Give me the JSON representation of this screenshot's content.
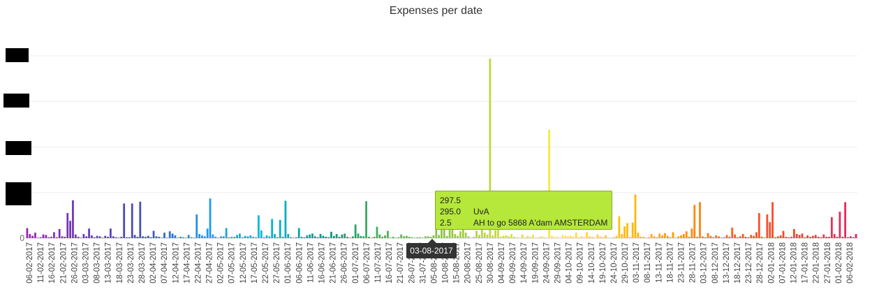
{
  "chart_data": {
    "type": "bar",
    "title": "Expenses per date",
    "xlabel": "",
    "ylabel": "",
    "ylim": [
      0,
      400
    ],
    "y_ticks": [
      {
        "value": 0,
        "label": "0"
      }
    ],
    "grid": "horizontal",
    "x_tick_labels": [
      "06-02-2017",
      "11-02-2017",
      "16-02-2017",
      "21-02-2017",
      "26-02-2017",
      "03-03-2017",
      "08-03-2017",
      "13-03-2017",
      "18-03-2017",
      "23-03-2017",
      "28-03-2017",
      "02-04-2017",
      "07-04-2017",
      "12-04-2017",
      "17-04-2017",
      "22-04-2017",
      "27-04-2017",
      "02-05-2017",
      "07-05-2017",
      "12-05-2017",
      "17-05-2017",
      "22-05-2017",
      "27-05-2017",
      "01-06-2017",
      "06-06-2017",
      "11-06-2017",
      "16-06-2017",
      "21-06-2017",
      "26-06-2017",
      "01-07-2017",
      "06-07-2017",
      "11-07-2017",
      "16-07-2017",
      "21-07-2017",
      "26-07-2017",
      "31-07-2017",
      "05-08-2017",
      "10-08-2017",
      "15-08-2017",
      "20-08-2017",
      "25-08-2017",
      "30-08-2017",
      "04-09-2017",
      "09-09-2017",
      "14-09-2017",
      "19-09-2017",
      "24-09-2017",
      "29-09-2017",
      "04-10-2017",
      "09-10-2017",
      "14-10-2017",
      "19-10-2017",
      "24-10-2017",
      "29-10-2017",
      "03-11-2017",
      "08-11-2017",
      "13-11-2017",
      "18-11-2017",
      "23-11-2017",
      "28-11-2017",
      "03-12-2017",
      "08-12-2017",
      "13-12-2017",
      "18-12-2017",
      "23-12-2017",
      "28-12-2017",
      "02-01-2018",
      "07-01-2018",
      "12-01-2018",
      "17-01-2018",
      "22-01-2018",
      "27-01-2018",
      "01-02-2018",
      "06-02-2018"
    ],
    "values": [
      22,
      9,
      5,
      12,
      1,
      2,
      8,
      7,
      2,
      3,
      13,
      2,
      20,
      4,
      3,
      55,
      38,
      83,
      8,
      3,
      1,
      9,
      4,
      21,
      6,
      2,
      5,
      4,
      1,
      5,
      3,
      21,
      4,
      2,
      1,
      3,
      76,
      2,
      2,
      76,
      7,
      3,
      80,
      4,
      3,
      5,
      2,
      16,
      4,
      3,
      1,
      12,
      1,
      15,
      10,
      6,
      1,
      3,
      2,
      1,
      7,
      2,
      1,
      52,
      9,
      6,
      4,
      21,
      87,
      8,
      3,
      1,
      4,
      4,
      22,
      2,
      3,
      3,
      7,
      10,
      2,
      5,
      4,
      6,
      3,
      2,
      50,
      17,
      2,
      6,
      4,
      42,
      9,
      2,
      40,
      3,
      82,
      9,
      2,
      1,
      2,
      22,
      3,
      2,
      6,
      8,
      10,
      4,
      2,
      9,
      5,
      3,
      2,
      14,
      5,
      9,
      3,
      8,
      10,
      3,
      1,
      4,
      30,
      10,
      5,
      4,
      81,
      3,
      1,
      3,
      25,
      8,
      3,
      6,
      16,
      1,
      3,
      1,
      2,
      8,
      4,
      5,
      3,
      2,
      1,
      2,
      2,
      1,
      4,
      4,
      3,
      6,
      45,
      7,
      19,
      26,
      5,
      98,
      22,
      9,
      5,
      15,
      20,
      12,
      4,
      1,
      3,
      16,
      7,
      24,
      12,
      8,
      394,
      6,
      18,
      35,
      3,
      5,
      6,
      4,
      9,
      3,
      2,
      1,
      8,
      2,
      5,
      3,
      7,
      1,
      2,
      4,
      3,
      1,
      238,
      5,
      3,
      3,
      1,
      7,
      5,
      4,
      5,
      3,
      12,
      2,
      4,
      2,
      13,
      4,
      3,
      1,
      8,
      3,
      2,
      6,
      1,
      1,
      2,
      5,
      48,
      9,
      26,
      33,
      2,
      34,
      96,
      12,
      3,
      3,
      1,
      2,
      9,
      4,
      2,
      10,
      6,
      11,
      5,
      2,
      13,
      1,
      4,
      6,
      9,
      15,
      3,
      21,
      73,
      3,
      79,
      4,
      2,
      11,
      5,
      2,
      6,
      4,
      1,
      2,
      7,
      3,
      23,
      8,
      2,
      4,
      9,
      3,
      2,
      7,
      5,
      13,
      55,
      3,
      1,
      52,
      35,
      79,
      2,
      4,
      6,
      16,
      3,
      2,
      3,
      20,
      9,
      7,
      10,
      2,
      6,
      3,
      5,
      7,
      3,
      2,
      8,
      3,
      3,
      46,
      9,
      3,
      58,
      3,
      79,
      2,
      4,
      2,
      9
    ],
    "colors": [
      "#9c27b0",
      "#673ab7",
      "#3f51b5",
      "#2196f3",
      "#00bcd4",
      "#009688",
      "#4caf50",
      "#8bc34a",
      "#cddc39",
      "#ffeb3b",
      "#ffc107",
      "#ff9800",
      "#ff5722",
      "#f44336",
      "#e91e63"
    ],
    "tooltip": {
      "date": "03-08-2017",
      "rows": [
        {
          "amount": "297.5",
          "desc": ""
        },
        {
          "amount": "295.0",
          "desc": "UvA"
        },
        {
          "amount": "2.5",
          "desc": "AH to go 5868 A'dam AMSTERDAM"
        }
      ],
      "background": "#b5e83a"
    }
  }
}
